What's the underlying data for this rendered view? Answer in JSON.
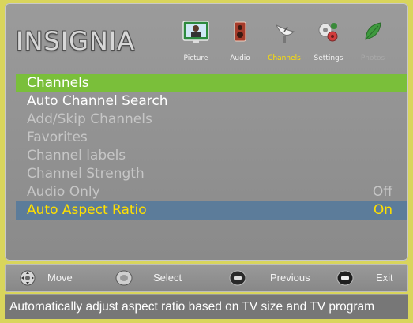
{
  "brand": {
    "logo_text": "INSIGNIA"
  },
  "tabs": [
    {
      "name": "picture",
      "label": "Picture",
      "icon": "tv-picture-icon",
      "state": "normal"
    },
    {
      "name": "audio",
      "label": "Audio",
      "icon": "speaker-icon",
      "state": "normal"
    },
    {
      "name": "channels",
      "label": "Channels",
      "icon": "satellite-dish-icon",
      "state": "active"
    },
    {
      "name": "settings",
      "label": "Settings",
      "icon": "gears-icon",
      "state": "normal"
    },
    {
      "name": "photos",
      "label": "Photos",
      "icon": "leaf-icon",
      "state": "disabled"
    }
  ],
  "menu": {
    "title": "Channels",
    "items": [
      {
        "label": "Auto Channel Search",
        "value": "",
        "state": "enabled"
      },
      {
        "label": "Add/Skip Channels",
        "value": "",
        "state": "disabled"
      },
      {
        "label": "Favorites",
        "value": "",
        "state": "disabled"
      },
      {
        "label": "Channel labels",
        "value": "",
        "state": "disabled"
      },
      {
        "label": "Channel Strength",
        "value": "",
        "state": "disabled"
      },
      {
        "label": "Audio Only",
        "value": "Off",
        "state": "disabled"
      },
      {
        "label": "Auto Aspect Ratio",
        "value": "On",
        "state": "selected"
      }
    ]
  },
  "footer": {
    "move": "Move",
    "select": "Select",
    "previous": "Previous",
    "exit": "Exit"
  },
  "help_text": "Automatically adjust aspect ratio based on TV size and TV program",
  "colors": {
    "frame": "#d9d55c",
    "title_bar": "#7abf3a",
    "selected_bar": "#5c7c9a",
    "selected_text": "#ffe000",
    "disabled_text": "#c6c6c6"
  }
}
